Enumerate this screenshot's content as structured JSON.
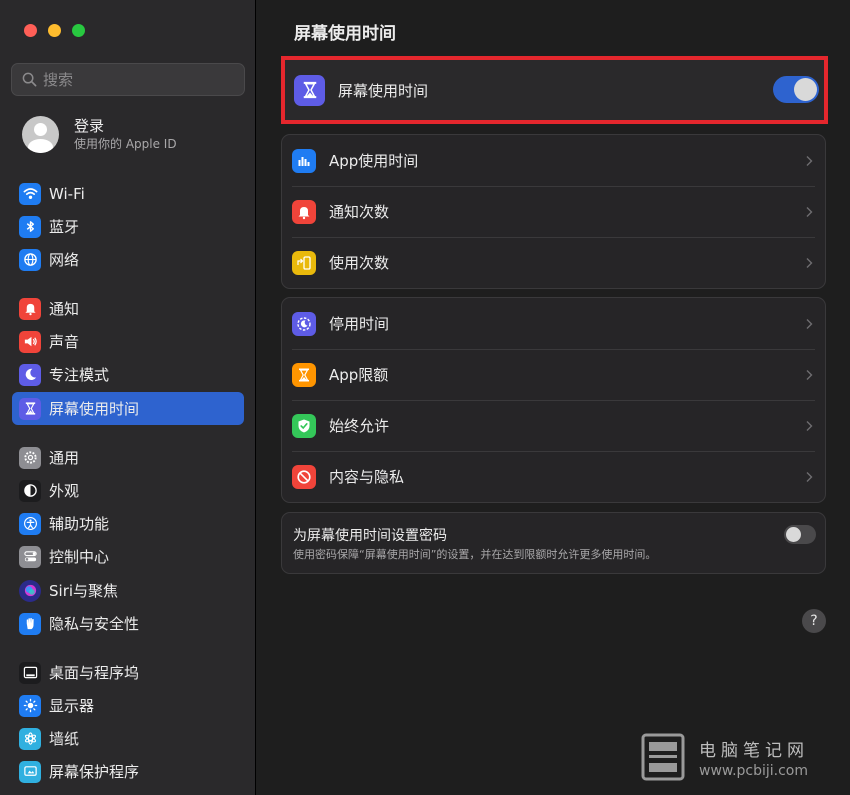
{
  "window": {
    "title": "屏幕使用时间"
  },
  "search": {
    "placeholder": "搜索"
  },
  "account": {
    "name": "登录",
    "subtitle": "使用你的 Apple ID"
  },
  "sidebar": {
    "items": [
      {
        "label": "Wi-Fi",
        "icon": "wifi-icon",
        "color": "#1f7cf2"
      },
      {
        "label": "蓝牙",
        "icon": "bluetooth-icon",
        "color": "#1f7cf2"
      },
      {
        "label": "网络",
        "icon": "globe-icon",
        "color": "#1f7cf2"
      },
      {
        "label": "通知",
        "icon": "bell-icon",
        "color": "#f0443a"
      },
      {
        "label": "声音",
        "icon": "speaker-icon",
        "color": "#f0443a"
      },
      {
        "label": "专注模式",
        "icon": "moon-icon",
        "color": "#5e5ce6"
      },
      {
        "label": "屏幕使用时间",
        "icon": "hourglass-icon",
        "color": "#5e5ce6",
        "selected": true
      },
      {
        "label": "通用",
        "icon": "gear-icon",
        "color": "#8e8e93"
      },
      {
        "label": "外观",
        "icon": "appearance-icon",
        "color": "#1c1c1e"
      },
      {
        "label": "辅助功能",
        "icon": "accessibility-icon",
        "color": "#1f7cf2"
      },
      {
        "label": "控制中心",
        "icon": "control-center-icon",
        "color": "#8e8e93"
      },
      {
        "label": "Siri与聚焦",
        "icon": "siri-icon",
        "color": "#2b2b8a"
      },
      {
        "label": "隐私与安全性",
        "icon": "hand-icon",
        "color": "#1f7cf2"
      },
      {
        "label": "桌面与程序坞",
        "icon": "dock-icon",
        "color": "#1c1c1e"
      },
      {
        "label": "显示器",
        "icon": "sun-icon",
        "color": "#1f7cf2"
      },
      {
        "label": "墙纸",
        "icon": "flower-icon",
        "color": "#30b0e0"
      },
      {
        "label": "屏幕保护程序",
        "icon": "screensaver-icon",
        "color": "#30b0e0"
      }
    ]
  },
  "main": {
    "title": "屏幕使用时间",
    "screen_time_row": {
      "label": "屏幕使用时间",
      "toggle_on": true
    },
    "group1": [
      {
        "label": "App使用时间",
        "icon": "bar-chart-icon",
        "color": "#1f7cf2"
      },
      {
        "label": "通知次数",
        "icon": "bell-icon",
        "color": "#f0443a"
      },
      {
        "label": "使用次数",
        "icon": "pickup-icon",
        "color": "#e9b90c"
      }
    ],
    "group2": [
      {
        "label": "停用时间",
        "icon": "downtime-icon",
        "color": "#5e5ce6"
      },
      {
        "label": "App限额",
        "icon": "hourglass-icon",
        "color": "#ff9500"
      },
      {
        "label": "始终允许",
        "icon": "checkmark-shield-icon",
        "color": "#34c759"
      },
      {
        "label": "内容与隐私",
        "icon": "no-entry-icon",
        "color": "#f0443a"
      }
    ],
    "passcode": {
      "title": "为屏幕使用时间设置密码",
      "description": "使用密码保障“屏幕使用时间”的设置，并在达到限额时允许更多使用时间。",
      "toggle_on": false
    },
    "help_label": "?"
  },
  "watermark": {
    "name": "电脑笔记网",
    "url": "www.pcbiji.com"
  }
}
